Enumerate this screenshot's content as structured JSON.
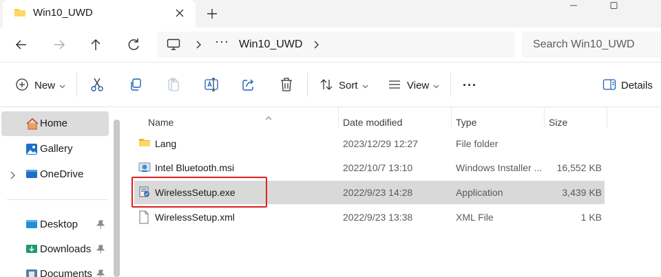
{
  "window": {
    "tab_title": "Win10_UWD",
    "controls": [
      "minimize",
      "maximize"
    ]
  },
  "address": {
    "overflow": "···",
    "crumb": "Win10_UWD",
    "search_placeholder": "Search Win10_UWD"
  },
  "commandbar": {
    "new_label": "New",
    "sort_label": "Sort",
    "view_label": "View",
    "more_label": "···",
    "details_label": "Details"
  },
  "sidebar": {
    "items": [
      {
        "label": "Home",
        "icon": "home-icon"
      },
      {
        "label": "Gallery",
        "icon": "gallery-icon"
      },
      {
        "label": "OneDrive",
        "icon": "onedrive-icon"
      },
      {
        "label": "Desktop",
        "icon": "desktop-folder-icon"
      },
      {
        "label": "Downloads",
        "icon": "downloads-folder-icon"
      },
      {
        "label": "Documents",
        "icon": "documents-folder-icon"
      }
    ]
  },
  "list": {
    "columns": {
      "name": "Name",
      "date": "Date modified",
      "type": "Type",
      "size": "Size"
    },
    "rows": [
      {
        "name": "Lang",
        "date": "2023/12/29 12:27",
        "type": "File folder",
        "size": "",
        "icon": "folder-icon"
      },
      {
        "name": "Intel Bluetooth.msi",
        "date": "2022/10/7 13:10",
        "type": "Windows Installer ...",
        "size": "16,552 KB",
        "icon": "msi-installer-icon"
      },
      {
        "name": "WirelessSetup.exe",
        "date": "2022/9/23 14:28",
        "type": "Application",
        "size": "3,439 KB",
        "icon": "setup-exe-icon"
      },
      {
        "name": "WirelessSetup.xml",
        "date": "2022/9/23 13:38",
        "type": "XML File",
        "size": "1 KB",
        "icon": "xml-file-icon"
      }
    ],
    "selected_row": "WirelessSetup.exe",
    "highlight_color": "#e02020"
  }
}
